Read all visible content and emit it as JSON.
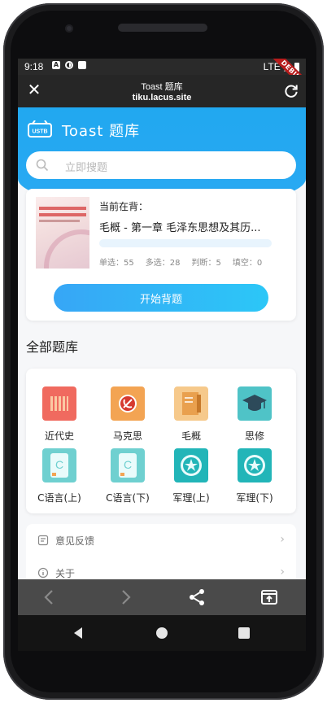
{
  "statusbar": {
    "time": "9:18",
    "network": "LTE",
    "debug": "DEBUG"
  },
  "appbar": {
    "title": "Toast 题库",
    "url": "tiku.lacus.site"
  },
  "app": {
    "title": "Toast 题库",
    "logo_text": "USTB"
  },
  "search": {
    "placeholder": "立即搜题"
  },
  "current": {
    "label": "当前在背：",
    "title": "毛概 - 第一章 毛泽东思想及其历...",
    "progress": 0,
    "stats": [
      "单选：55",
      "多选：28",
      "判断：5",
      "填空：0"
    ],
    "start_label": "开始背题"
  },
  "library": {
    "title": "全部题库",
    "items": [
      {
        "label": "近代史",
        "icon": "history-book-icon",
        "color": "#f06a5f"
      },
      {
        "label": "马克思",
        "icon": "hammer-sickle-icon",
        "color": "#f3a453"
      },
      {
        "label": "毛概",
        "icon": "notebook-icon",
        "color": "#f6c98b"
      },
      {
        "label": "思修",
        "icon": "graduation-cap-icon",
        "color": "#4fc3c7"
      },
      {
        "label": "C语言(上)",
        "icon": "c-language-icon",
        "color": "#6fd0d0"
      },
      {
        "label": "C语言(下)",
        "icon": "c-language-icon",
        "color": "#6fd0d0"
      },
      {
        "label": "军理(上)",
        "icon": "military-emblem-icon",
        "color": "#22b5b8"
      },
      {
        "label": "军理(下)",
        "icon": "military-emblem-icon",
        "color": "#22b5b8"
      }
    ]
  },
  "menu": [
    {
      "label": "意见反馈",
      "icon": "feedback-icon"
    },
    {
      "label": "关于",
      "icon": "info-icon"
    }
  ],
  "colors": {
    "accent": "#21a8f0",
    "button_start": "#37a6f6",
    "button_end": "#2cc7f7"
  }
}
